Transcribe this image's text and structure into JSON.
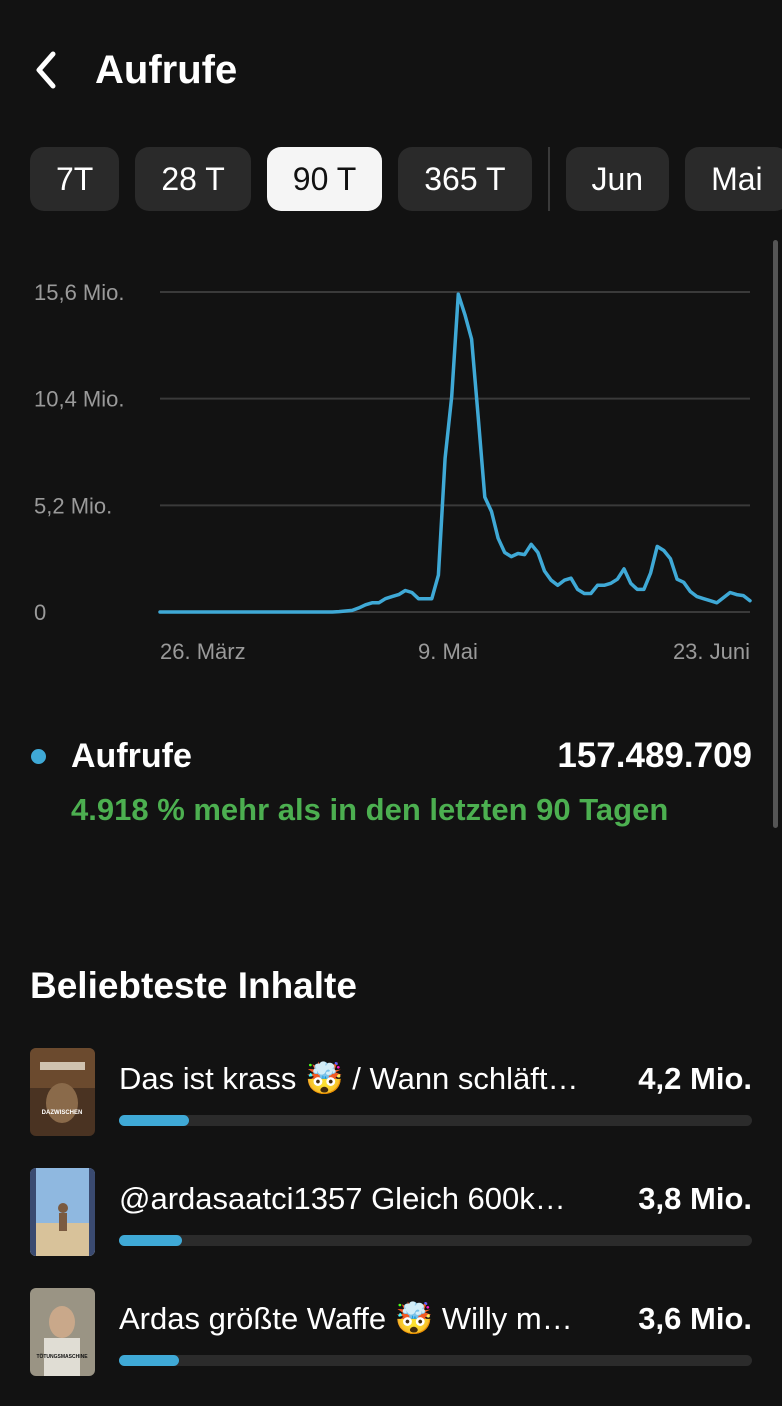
{
  "header": {
    "title": "Aufrufe"
  },
  "tabs": [
    {
      "label": "7T",
      "selected": false
    },
    {
      "label": "28 T",
      "selected": false
    },
    {
      "label": "90 T",
      "selected": true
    },
    {
      "label": "365 T",
      "selected": false
    },
    {
      "label": "Jun",
      "selected": false
    },
    {
      "label": "Mai",
      "selected": false
    }
  ],
  "chart_data": {
    "type": "line",
    "y_ticks": [
      "15,6 Mio.",
      "10,4 Mio.",
      "5,2 Mio.",
      "0"
    ],
    "y_tick_values": [
      15.6,
      10.4,
      5.2,
      0
    ],
    "x_ticks": [
      "26. März",
      "9. Mai",
      "23. Juni"
    ],
    "ylim": [
      0,
      15.6
    ],
    "unit": "Mio.",
    "grid": true,
    "line_color": "#3fa9d6",
    "series": [
      {
        "values": [
          0,
          0,
          0,
          0,
          0,
          0,
          0,
          0,
          0,
          0,
          0,
          0,
          0,
          0,
          0,
          0,
          0,
          0,
          0,
          0,
          0,
          0,
          0,
          0,
          0,
          0,
          0,
          0.02,
          0.05,
          0.08,
          0.2,
          0.35,
          0.45,
          0.45,
          0.65,
          0.75,
          0.85,
          1.05,
          0.95,
          0.65,
          0.65,
          0.65,
          1.8,
          7.5,
          10.5,
          15.5,
          14.5,
          13.3,
          9.5,
          5.6,
          4.9,
          3.6,
          2.9,
          2.7,
          2.85,
          2.8,
          3.3,
          2.9,
          2.0,
          1.55,
          1.3,
          1.55,
          1.65,
          1.1,
          0.9,
          0.9,
          1.3,
          1.3,
          1.4,
          1.6,
          2.1,
          1.4,
          1.1,
          1.1,
          1.9,
          3.2,
          3.0,
          2.6,
          1.6,
          1.45,
          1.0,
          0.75,
          0.65,
          0.55,
          0.45,
          0.7,
          0.95,
          0.85,
          0.8,
          0.55
        ]
      }
    ]
  },
  "summary": {
    "label": "Aufrufe",
    "total": "157.489.709",
    "change_text": "4.918 % mehr als in den letzten 90 Tagen"
  },
  "top_content": {
    "title": "Beliebteste Inhalte",
    "items": [
      {
        "title": "Das ist krass 🤯 / Wann schläft…",
        "value": "4,2 Mio.",
        "fraction": 0.11,
        "thumb_caption": "DAZWISCHEN"
      },
      {
        "title": "@ardasaatci1357 Gleich 600k…",
        "value": "3,8 Mio.",
        "fraction": 0.1,
        "thumb_caption": ""
      },
      {
        "title": "Ardas größte Waffe 🤯 Willy m…",
        "value": "3,6 Mio.",
        "fraction": 0.095,
        "thumb_caption": "TÖTUNGSMASCHINE"
      }
    ]
  },
  "icons": {
    "back": "chevron-left-icon"
  },
  "colors": {
    "background": "#121212",
    "accent": "#3fa9d6",
    "positive": "#4caf50",
    "tab_bg": "#2a2a2a",
    "tab_selected_bg": "#f5f5f5"
  }
}
